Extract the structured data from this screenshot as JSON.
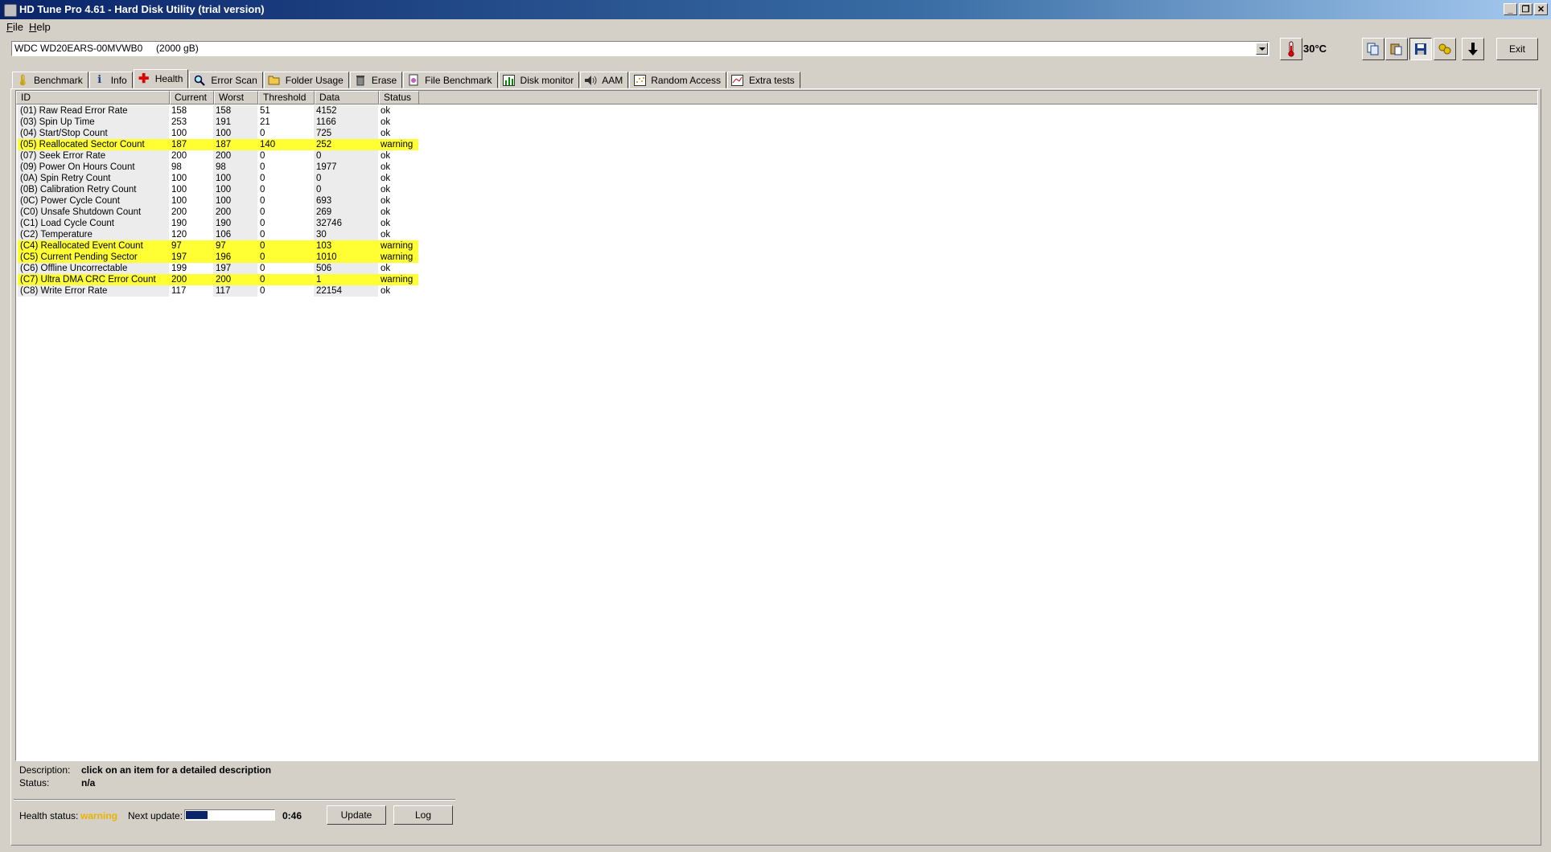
{
  "window": {
    "title": "HD Tune Pro 4.61 - Hard Disk Utility (trial version)",
    "buttons": [
      "_",
      "❐",
      "✕"
    ]
  },
  "menu": [
    {
      "accel": "F",
      "rest": "ile"
    },
    {
      "accel": "H",
      "rest": "elp"
    }
  ],
  "drive": {
    "selected": "WDC WD20EARS-00MVWB0     (2000 gB)",
    "temperature": "30°C"
  },
  "toolbar": {
    "exit_label": "Exit",
    "icons": [
      "copy-icon",
      "paste-icon",
      "save-icon",
      "options-icon",
      "download-icon"
    ]
  },
  "tabs": [
    {
      "label": "Benchmark",
      "icon": "thermometer-icon",
      "glyph": "🌡"
    },
    {
      "label": "Info",
      "icon": "info-icon",
      "glyph": "i"
    },
    {
      "label": "Health",
      "icon": "health-cross-icon",
      "glyph": "✚",
      "active": true
    },
    {
      "label": "Error Scan",
      "icon": "magnifier-icon",
      "glyph": "🔍"
    },
    {
      "label": "Folder Usage",
      "icon": "folder-icon",
      "glyph": "📁"
    },
    {
      "label": "Erase",
      "icon": "trash-icon",
      "glyph": "🗑"
    },
    {
      "label": "File Benchmark",
      "icon": "file-benchmark-icon",
      "glyph": "⏱"
    },
    {
      "label": "Disk monitor",
      "icon": "chart-icon",
      "glyph": "▥"
    },
    {
      "label": "AAM",
      "icon": "speaker-icon",
      "glyph": "🔊"
    },
    {
      "label": "Random Access",
      "icon": "random-access-icon",
      "glyph": "⁘"
    },
    {
      "label": "Extra tests",
      "icon": "extra-tests-icon",
      "glyph": "▦"
    }
  ],
  "table": {
    "headers": [
      "ID",
      "Current",
      "Worst",
      "Threshold",
      "Data",
      "Status"
    ],
    "rows": [
      [
        "(01) Raw Read Error Rate",
        "158",
        "158",
        "51",
        "4152",
        "ok"
      ],
      [
        "(03) Spin Up Time",
        "253",
        "191",
        "21",
        "1166",
        "ok"
      ],
      [
        "(04) Start/Stop Count",
        "100",
        "100",
        "0",
        "725",
        "ok"
      ],
      [
        "(05) Reallocated Sector Count",
        "187",
        "187",
        "140",
        "252",
        "warning"
      ],
      [
        "(07) Seek Error Rate",
        "200",
        "200",
        "0",
        "0",
        "ok"
      ],
      [
        "(09) Power On Hours Count",
        "98",
        "98",
        "0",
        "1977",
        "ok"
      ],
      [
        "(0A) Spin Retry Count",
        "100",
        "100",
        "0",
        "0",
        "ok"
      ],
      [
        "(0B) Calibration Retry Count",
        "100",
        "100",
        "0",
        "0",
        "ok"
      ],
      [
        "(0C) Power Cycle Count",
        "100",
        "100",
        "0",
        "693",
        "ok"
      ],
      [
        "(C0) Unsafe Shutdown Count",
        "200",
        "200",
        "0",
        "269",
        "ok"
      ],
      [
        "(C1) Load Cycle Count",
        "190",
        "190",
        "0",
        "32746",
        "ok"
      ],
      [
        "(C2) Temperature",
        "120",
        "106",
        "0",
        "30",
        "ok"
      ],
      [
        "(C4) Reallocated Event Count",
        "97",
        "97",
        "0",
        "103",
        "warning"
      ],
      [
        "(C5) Current Pending Sector",
        "197",
        "196",
        "0",
        "1010",
        "warning"
      ],
      [
        "(C6) Offline Uncorrectable",
        "199",
        "197",
        "0",
        "506",
        "ok"
      ],
      [
        "(C7) Ultra DMA CRC Error Count",
        "200",
        "200",
        "0",
        "1",
        "warning"
      ],
      [
        "(C8) Write Error Rate",
        "117",
        "117",
        "0",
        "22154",
        "ok"
      ]
    ]
  },
  "details": {
    "description_label": "Description:",
    "description_value": "click on an item for a detailed description",
    "status_label": "Status:",
    "status_value": "n/a"
  },
  "footer": {
    "health_label": "Health status:",
    "health_value": "warning",
    "health_color": "#e8b400",
    "next_update_label": "Next update:",
    "next_update_progress": 0.25,
    "countdown": "0:46",
    "update_label": "Update",
    "log_label": "Log"
  }
}
